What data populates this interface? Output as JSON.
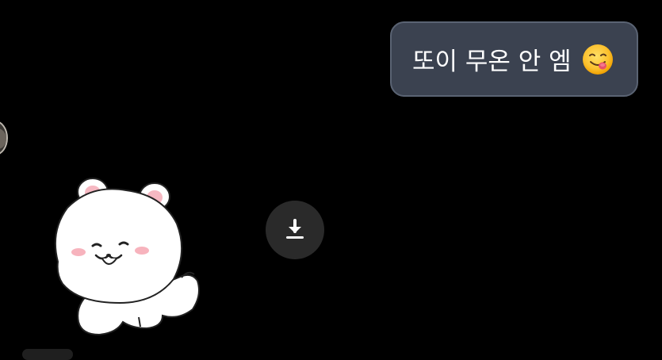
{
  "chat": {
    "outgoing_message": {
      "text": "또이 무온 안 엠",
      "emoji": "savoring-food-face-icon"
    },
    "incoming_sticker": {
      "icon": "white-bear-sticker"
    },
    "actions": {
      "download_icon": "download-icon"
    }
  },
  "colors": {
    "background": "#000000",
    "bubble_fill": "#3b4250",
    "bubble_border": "#5a6373",
    "text": "#ffffff",
    "download_button": "#2a2a2a"
  }
}
